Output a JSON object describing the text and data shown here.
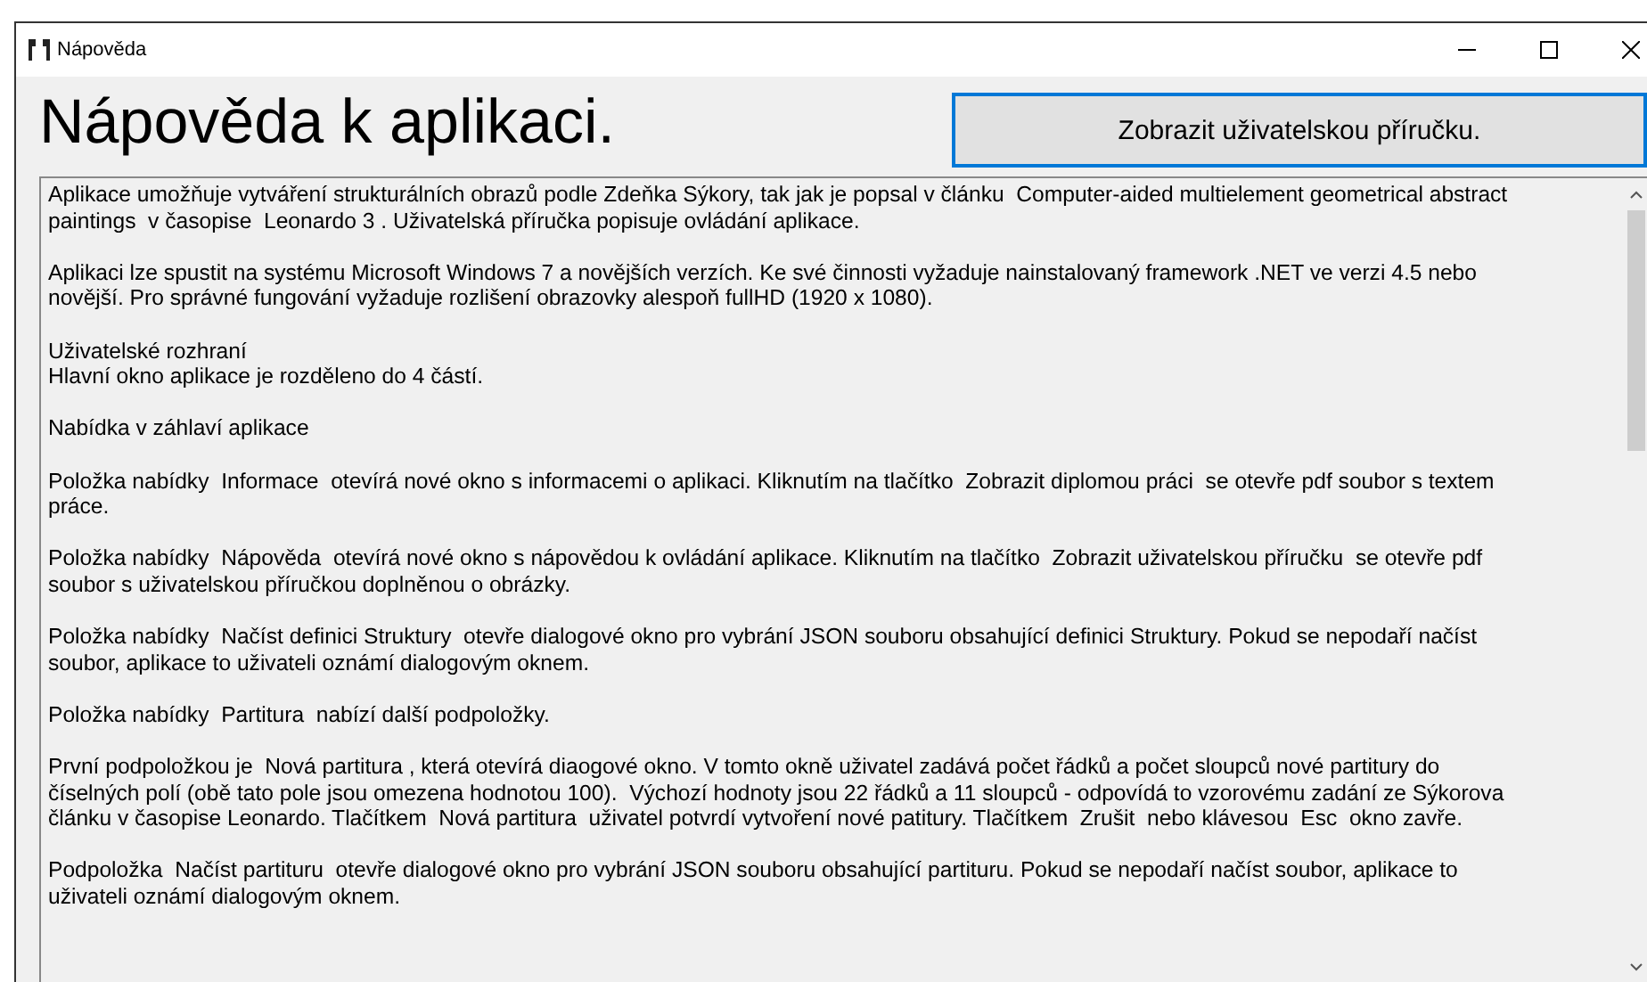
{
  "window": {
    "title": "Nápověda"
  },
  "heading": "Nápověda k aplikaci.",
  "manual_button": "Zobrazit uživatelskou příručku.",
  "help_text": [
    {
      "lines": [
        "Aplikace umožňuje vytváření strukturálních obrazů podle Zdeňka Sýkory, tak jak je popsal v článku  Computer-aided multielement geometrical abstract",
        "paintings  v časopise  Leonardo 3 . Uživatelská příručka popisuje ovládání aplikace."
      ]
    },
    {
      "lines": [
        "Aplikaci lze spustit na systému Microsoft Windows 7 a novějších verzích. Ke své činnosti vyžaduje nainstalovaný framework .NET ve verzi 4.5 nebo",
        "novější. Pro správné fungování vyžaduje rozlišení obrazovky alespoň fullHD (1920 x 1080)."
      ]
    },
    {
      "lines": [
        "Uživatelské rozhraní",
        "Hlavní okno aplikace je rozděleno do 4 částí."
      ]
    },
    {
      "lines": [
        "Nabídka v záhlaví aplikace"
      ]
    },
    {
      "lines": [
        "Položka nabídky  Informace  otevírá nové okno s informacemi o aplikaci. Kliknutím na tlačítko  Zobrazit diplomou práci  se otevře pdf soubor s textem",
        "práce."
      ]
    },
    {
      "lines": [
        "Položka nabídky  Nápověda  otevírá nové okno s nápovědou k ovládání aplikace. Kliknutím na tlačítko  Zobrazit uživatelskou příručku  se otevře pdf",
        "soubor s uživatelskou příručkou doplněnou o obrázky."
      ]
    },
    {
      "lines": [
        "Položka nabídky  Načíst definici Struktury  otevře dialogové okno pro vybrání JSON souboru obsahující definici Struktury. Pokud se nepodaří načíst",
        "soubor, aplikace to uživateli oznámí dialogovým oknem."
      ]
    },
    {
      "lines": [
        "Položka nabídky  Partitura  nabízí další podpoložky."
      ]
    },
    {
      "lines": [
        "První podpoložkou je  Nová partitura , která otevírá diaogové okno. V tomto okně uživatel zadává počet řádků a počet sloupců nové partitury do",
        "číselných polí (obě tato pole jsou omezena hodnotou 100).  Výchozí hodnoty jsou 22 řádků a 11 sloupců - odpovídá to vzorovému zadání ze Sýkorova",
        "článku v časopise Leonardo. Tlačítkem  Nová partitura  uživatel potvrdí vytvoření nové patitury. Tlačítkem  Zrušit  nebo klávesou  Esc  okno zavře."
      ]
    },
    {
      "lines": [
        "Podpoložka  Načíst partituru  otevře dialogové okno pro vybrání JSON souboru obsahující partituru. Pokud se nepodaří načíst soubor, aplikace to",
        "uživateli oznámí dialogovým oknem."
      ]
    }
  ]
}
